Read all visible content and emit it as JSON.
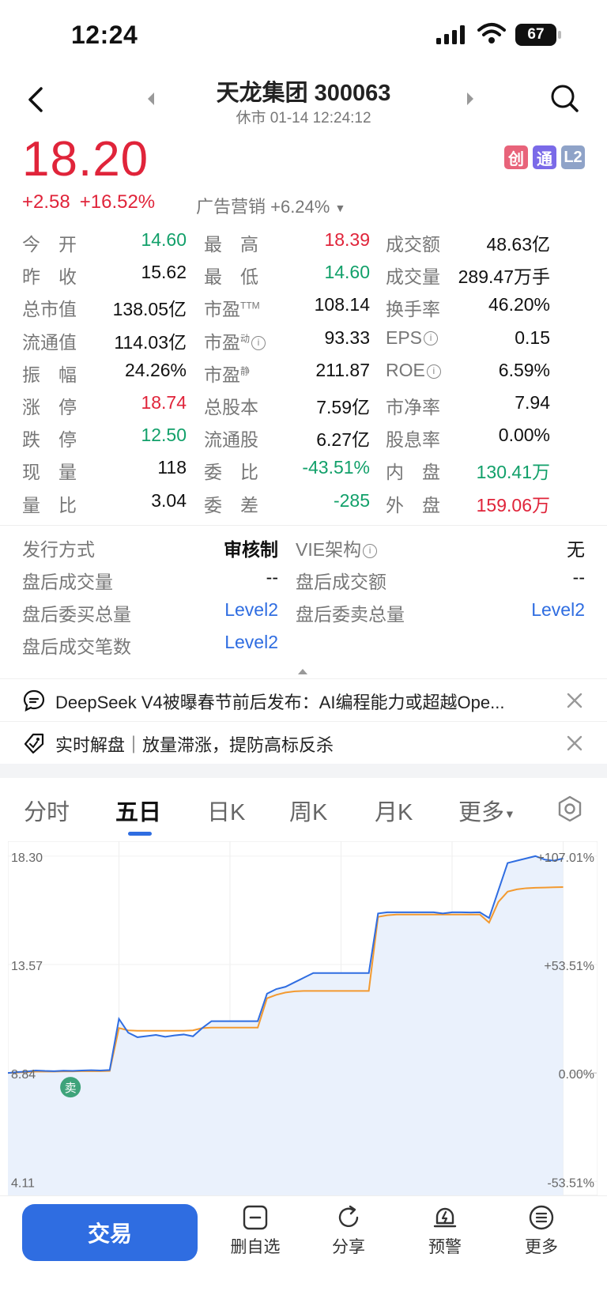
{
  "status_bar": {
    "time": "12:24",
    "battery": "67"
  },
  "header": {
    "title": "天龙集团 300063",
    "subtitle": "休市 01-14 12:24:12"
  },
  "price": {
    "last": "18.20",
    "change": "+2.58",
    "change_pct": "+16.52%",
    "sector": "广告营销 +6.24%",
    "badges": [
      "创",
      "通",
      "L2"
    ]
  },
  "quote": {
    "rows": [
      [
        {
          "l": "今　开",
          "v": "14.60",
          "c": "g"
        },
        {
          "l": "最　高",
          "v": "18.39",
          "c": "r"
        },
        {
          "l": "成交额",
          "v": "48.63亿",
          "c": "k"
        }
      ],
      [
        {
          "l": "昨　收",
          "v": "15.62",
          "c": "k"
        },
        {
          "l": "最　低",
          "v": "14.60",
          "c": "g"
        },
        {
          "l": "成交量",
          "v": "289.47万手",
          "c": "k"
        }
      ],
      [
        {
          "l": "总市值",
          "v": "138.05亿",
          "c": "k"
        },
        {
          "l": "市盈",
          "sup": "TTM",
          "v": "108.14",
          "c": "k"
        },
        {
          "l": "换手率",
          "v": "46.20%",
          "c": "k"
        }
      ],
      [
        {
          "l": "流通值",
          "v": "114.03亿",
          "c": "k"
        },
        {
          "l": "市盈",
          "sup": "动",
          "info": true,
          "v": "93.33",
          "c": "k"
        },
        {
          "l": "EPS",
          "info": true,
          "v": "0.15",
          "c": "k"
        }
      ],
      [
        {
          "l": "振　幅",
          "v": "24.26%",
          "c": "k"
        },
        {
          "l": "市盈",
          "sup": "静",
          "v": "211.87",
          "c": "k"
        },
        {
          "l": "ROE",
          "info": true,
          "v": "6.59%",
          "c": "k"
        }
      ],
      [
        {
          "l": "涨　停",
          "v": "18.74",
          "c": "r"
        },
        {
          "l": "总股本",
          "v": "7.59亿",
          "c": "k"
        },
        {
          "l": "市净率",
          "v": "7.94",
          "c": "k"
        }
      ],
      [
        {
          "l": "跌　停",
          "v": "12.50",
          "c": "g"
        },
        {
          "l": "流通股",
          "v": "6.27亿",
          "c": "k"
        },
        {
          "l": "股息率",
          "v": "0.00%",
          "c": "k"
        }
      ],
      [
        {
          "l": "现　量",
          "v": "118",
          "c": "k"
        },
        {
          "l": "委　比",
          "v": "-43.51%",
          "c": "g"
        },
        {
          "l": "内　盘",
          "v": "130.41万",
          "c": "g"
        }
      ],
      [
        {
          "l": "量　比",
          "v": "3.04",
          "c": "k"
        },
        {
          "l": "委　差",
          "v": "-285",
          "c": "g"
        },
        {
          "l": "外　盘",
          "v": "159.06万",
          "c": "r"
        }
      ]
    ]
  },
  "issue": {
    "rows": [
      [
        {
          "l": "发行方式",
          "v": "审核制",
          "c": "k",
          "bold": true
        },
        {
          "l": "VIE架构",
          "info": true,
          "v": "无",
          "c": "k"
        }
      ],
      [
        {
          "l": "盘后成交量",
          "v": "--",
          "c": "k"
        },
        {
          "l": "盘后成交额",
          "v": "--",
          "c": "k"
        }
      ],
      [
        {
          "l": "盘后委买总量",
          "v": "Level2",
          "c": "b"
        },
        {
          "l": "盘后委卖总量",
          "v": "Level2",
          "c": "b"
        }
      ],
      [
        {
          "l": "盘后成交笔数",
          "v": "Level2",
          "c": "b"
        }
      ]
    ]
  },
  "news": [
    {
      "text": "DeepSeek V4被曝春节前后发布：AI编程能力或超越Ope..."
    },
    {
      "text": "实时解盘｜放量滞涨，提防高标反杀"
    }
  ],
  "tabs": [
    "分时",
    "五日",
    "日K",
    "周K",
    "月K",
    "更多"
  ],
  "active_tab": 1,
  "chart_data": {
    "type": "line",
    "title": "",
    "days": 5,
    "ylim": [
      4.11,
      18.3
    ],
    "y_ticks_left": [
      "18.30",
      "13.57",
      "8.84",
      "4.11"
    ],
    "y_ticks_right": [
      "+107.01%",
      "+53.51%",
      "0.00%",
      "-53.51%"
    ],
    "base": 8.84,
    "series": [
      {
        "color": "#2f6de1",
        "values": [
          8.84,
          8.88,
          8.9,
          8.95,
          8.93,
          8.92,
          8.94,
          8.93,
          8.95,
          8.96,
          8.95,
          8.97,
          11.2,
          10.6,
          10.4,
          10.45,
          10.5,
          10.42,
          10.48,
          10.52,
          10.44,
          10.8,
          11.1,
          11.1,
          11.1,
          11.1,
          11.1,
          11.1,
          12.3,
          12.5,
          12.6,
          12.8,
          13.0,
          13.2,
          13.2,
          13.2,
          13.2,
          13.2,
          13.2,
          13.2,
          15.8,
          15.85,
          15.85,
          15.85,
          15.85,
          15.85,
          15.85,
          15.8,
          15.85,
          15.85,
          15.84,
          15.85,
          15.6,
          16.8,
          18.0,
          18.1,
          18.2,
          18.3,
          18.15,
          18.1,
          18.2
        ]
      },
      {
        "color": "#f39a30",
        "values": [
          8.84,
          8.86,
          8.88,
          8.9,
          8.9,
          8.9,
          8.91,
          8.91,
          8.92,
          8.92,
          8.92,
          8.93,
          10.8,
          10.7,
          10.68,
          10.68,
          10.68,
          10.68,
          10.68,
          10.68,
          10.7,
          10.8,
          10.82,
          10.82,
          10.82,
          10.82,
          10.82,
          10.82,
          12.1,
          12.25,
          12.35,
          12.4,
          12.42,
          12.42,
          12.42,
          12.42,
          12.42,
          12.42,
          12.42,
          12.42,
          15.65,
          15.72,
          15.75,
          15.75,
          15.75,
          15.75,
          15.75,
          15.75,
          15.75,
          15.75,
          15.75,
          15.75,
          15.4,
          16.3,
          16.75,
          16.85,
          16.9,
          16.92,
          16.93,
          16.94,
          16.95
        ]
      }
    ],
    "markers": [
      {
        "label": "卖"
      }
    ]
  },
  "bottom_bar": {
    "trade": "交易",
    "items": [
      "删自选",
      "分享",
      "预警",
      "更多"
    ]
  },
  "colors": {
    "up": "#e0243a",
    "down": "#12a06a",
    "link": "#2f6de1",
    "accent": "#2f6de1"
  }
}
